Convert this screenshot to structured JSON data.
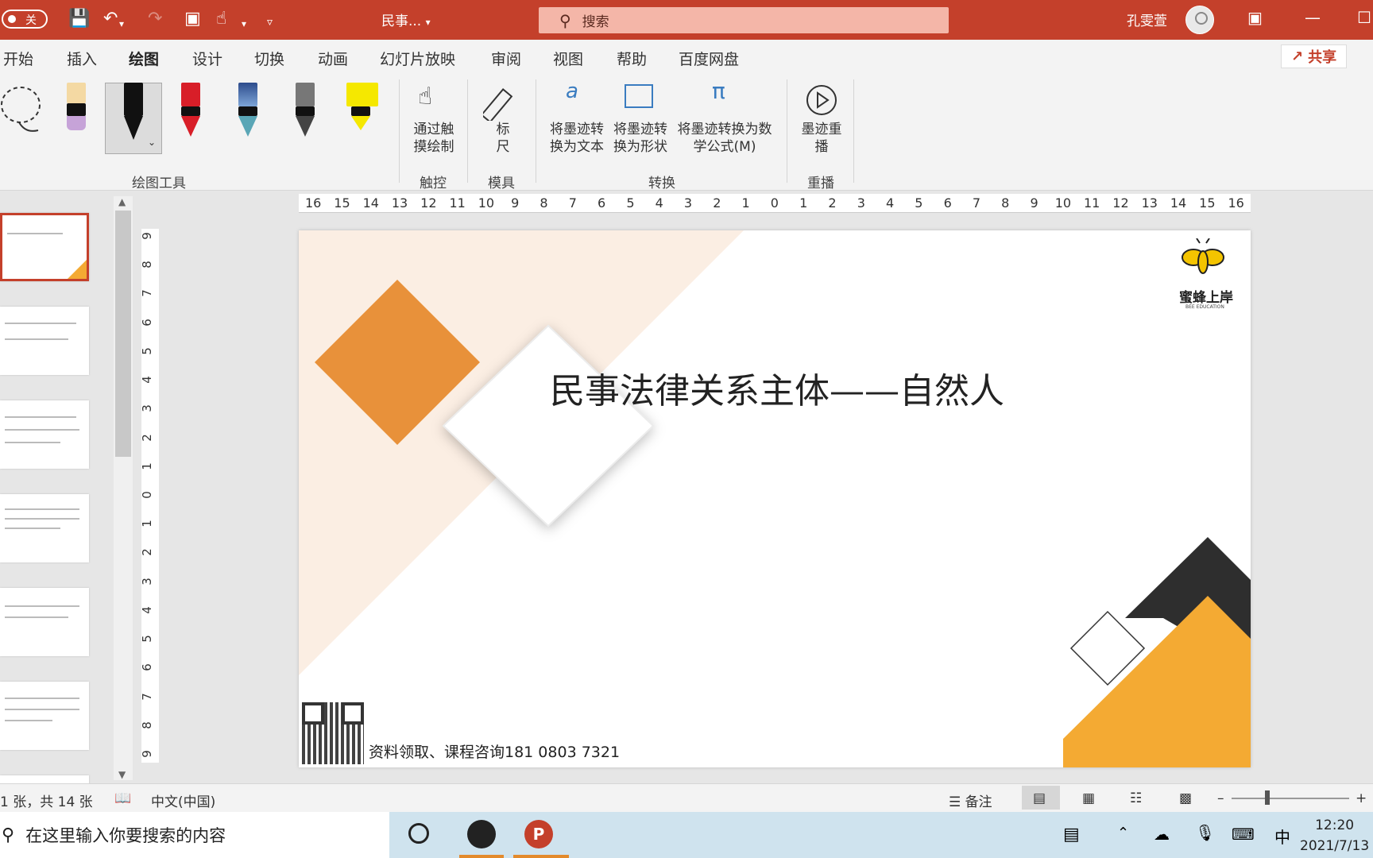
{
  "titlebar": {
    "autosave_label": "关",
    "doc_title": "民事...",
    "search_placeholder": "搜索",
    "user_name": "孔雯萱"
  },
  "tabs": [
    "开始",
    "插入",
    "绘图",
    "设计",
    "切换",
    "动画",
    "幻灯片放映",
    "审阅",
    "视图",
    "帮助",
    "百度网盘"
  ],
  "active_tab": "绘图",
  "share_label": "共享",
  "ribbon": {
    "groups": {
      "draw_tools": "绘图工具",
      "touch": "触控",
      "stencils": "模具",
      "convert": "转换",
      "replay": "重播"
    },
    "buttons": {
      "touch_draw": "通过触摸绘制",
      "ruler": "标尺",
      "ink_to_text": "将墨迹转换为文本",
      "ink_to_shape": "将墨迹转换为形状",
      "ink_to_math": "将墨迹转换为数学公式(M)",
      "ink_replay": "墨迹重播"
    },
    "pens": [
      {
        "name": "highlighter-pen",
        "color": "#f4d9a3"
      },
      {
        "name": "black-pen",
        "color": "#111111"
      },
      {
        "name": "red-pen",
        "color": "#d81e28"
      },
      {
        "name": "galaxy-pen",
        "color": "#2d4c8c"
      },
      {
        "name": "pencil",
        "color": "#777777"
      },
      {
        "name": "yellow-highlighter",
        "color": "#f5e800"
      }
    ]
  },
  "ruler": {
    "horizontal": [
      "16",
      "15",
      "14",
      "13",
      "12",
      "11",
      "10",
      "9",
      "8",
      "7",
      "6",
      "5",
      "4",
      "3",
      "2",
      "1",
      "0",
      "1",
      "2",
      "3",
      "4",
      "5",
      "6",
      "7",
      "8",
      "9",
      "10",
      "11",
      "12",
      "13",
      "14",
      "15",
      "16"
    ],
    "vertical": [
      "9",
      "8",
      "7",
      "6",
      "5",
      "4",
      "3",
      "2",
      "1",
      "0",
      "1",
      "2",
      "3",
      "4",
      "5",
      "6",
      "7",
      "8",
      "9"
    ]
  },
  "slide": {
    "title": "民事法律关系主体——自然人",
    "logo_name": "蜜蜂上岸",
    "logo_sub": "BEE EDUCATION",
    "contact": "资料领取、课程咨询181 0803 7321",
    "colors": {
      "orange": "#e8913a",
      "dark": "#2e2e2e",
      "gold": "#f4aa33",
      "cream": "#fbeee3"
    }
  },
  "statusbar": {
    "slide_count": "1 张，共 14 张",
    "language": "中文(中国)",
    "notes": "备注"
  },
  "taskbar": {
    "search_placeholder": "在这里输入你要搜索的内容",
    "ime": "中",
    "time": "12:20",
    "date": "2021/7/13"
  }
}
